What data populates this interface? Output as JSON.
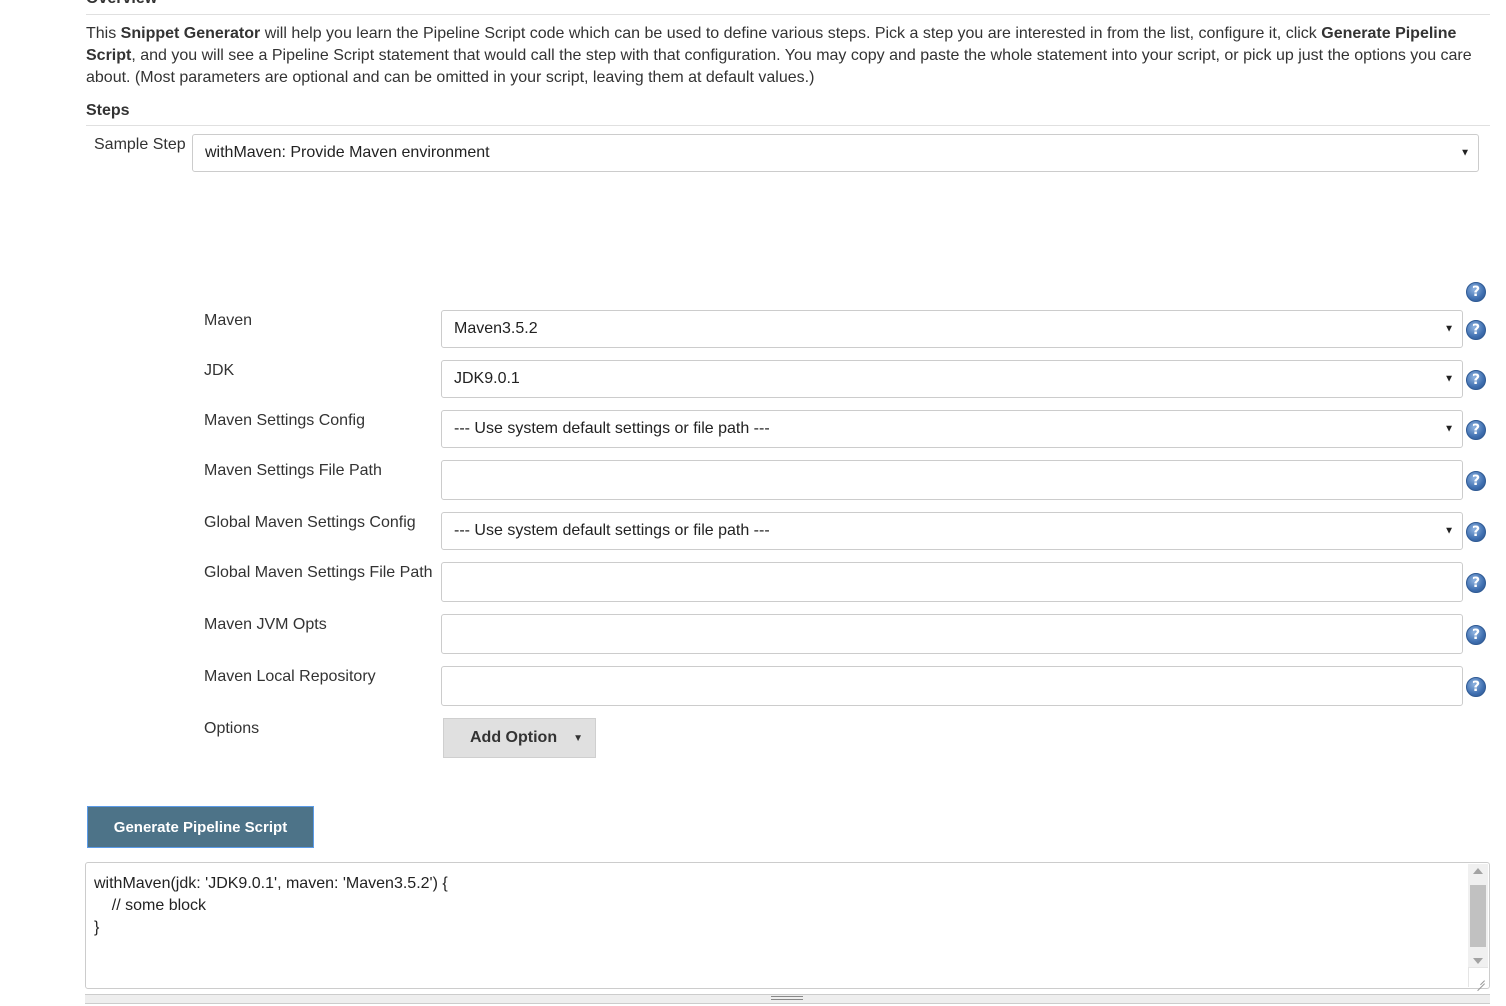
{
  "overview": {
    "title": "Overview",
    "description": {
      "part1": "This ",
      "bold1": "Snippet Generator",
      "part2": " will help you learn the Pipeline Script code which can be used to define various steps. Pick a step you are interested in from the list, configure it, click ",
      "bold2": "Generate Pipeline Script",
      "part3": ", and you will see a Pipeline Script statement that would call the step with that configuration. You may copy and paste the whole statement into your script, or pick up just the options you care about. (Most parameters are optional and can be omitted in your script, leaving them at default values.)"
    }
  },
  "steps": {
    "title": "Steps",
    "sample_step_label": "Sample Step",
    "sample_step_value": "withMaven: Provide Maven environment"
  },
  "fields": {
    "maven": {
      "label": "Maven",
      "value": "Maven3.5.2",
      "type": "select"
    },
    "jdk": {
      "label": "JDK",
      "value": "JDK9.0.1",
      "type": "select"
    },
    "maven_settings_config": {
      "label": "Maven Settings Config",
      "value": "--- Use system default settings or file path ---",
      "type": "select"
    },
    "maven_settings_file_path": {
      "label": "Maven Settings File Path",
      "value": "",
      "type": "text"
    },
    "global_maven_settings_config": {
      "label": "Global Maven Settings Config",
      "value": "--- Use system default settings or file path ---",
      "type": "select"
    },
    "global_maven_settings_file_path": {
      "label": "Global Maven Settings File Path",
      "value": "",
      "type": "text"
    },
    "maven_jvm_opts": {
      "label": "Maven JVM Opts",
      "value": "",
      "type": "text"
    },
    "maven_local_repository": {
      "label": "Maven Local Repository",
      "value": "",
      "type": "text"
    },
    "options": {
      "label": "Options",
      "button_label": "Add Option"
    }
  },
  "help_icon_glyph": "?",
  "caret_glyph": "▼",
  "generate_button_label": "Generate Pipeline Script",
  "output": {
    "text": "withMaven(jdk: 'JDK9.0.1', maven: 'Maven3.5.2') {\n    // some block\n}"
  }
}
